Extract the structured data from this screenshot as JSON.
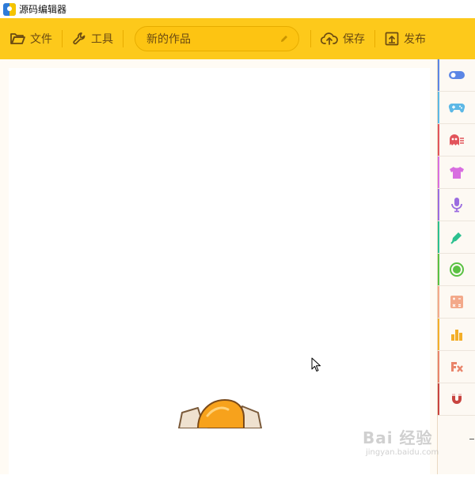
{
  "window": {
    "title": "源码编辑器"
  },
  "toolbar": {
    "file_label": "文件",
    "tools_label": "工具",
    "project_name": "新的作品",
    "save_label": "保存",
    "publish_label": "发布"
  },
  "sidebar": {
    "categories": [
      {
        "icon": "toggle-icon",
        "color": "#5b86e5"
      },
      {
        "icon": "gamepad-icon",
        "color": "#5cb8e6"
      },
      {
        "icon": "ghost-icon",
        "color": "#e2545b"
      },
      {
        "icon": "shirt-icon",
        "color": "#d86ee0"
      },
      {
        "icon": "microphone-icon",
        "color": "#9b6ce0"
      },
      {
        "icon": "pen-icon",
        "color": "#2cc08f"
      },
      {
        "icon": "circle-icon",
        "color": "#5ac143"
      },
      {
        "icon": "calculator-icon",
        "color": "#f3a98a"
      },
      {
        "icon": "bar-chart-icon",
        "color": "#f3ae28"
      },
      {
        "icon": "function-icon",
        "color": "#e9856b"
      },
      {
        "icon": "magnet-icon",
        "color": "#c8443f"
      }
    ]
  },
  "watermark": {
    "main": "Bai 经验",
    "sub": "jingyan.baidu.com"
  }
}
